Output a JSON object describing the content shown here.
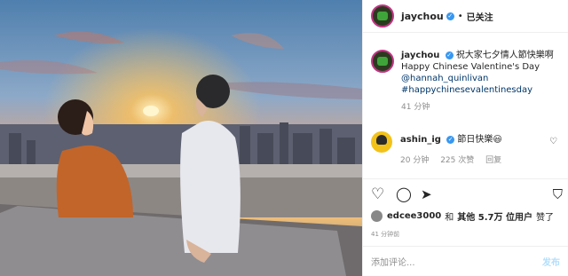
{
  "header": {
    "username": "jaychou",
    "follow_label": "已关注",
    "separator": "•"
  },
  "caption": {
    "username": "jaychou",
    "text_cn": "祝大家七夕情人節快樂啊",
    "text_en": "Happy Chinese Valentine's Day",
    "mention": "@hannah_quinlivan",
    "hashtag": "#happychinesevalentinesday",
    "time": "41 分钟"
  },
  "comment": {
    "username": "ashin_ig",
    "text": "節日快樂😃",
    "time": "20 分钟",
    "likes": "225 次赞",
    "reply": "回复"
  },
  "likes": {
    "liker": "edcee3000",
    "conj": "和",
    "others": "其他 5.7万 位用户",
    "suffix": "赞了"
  },
  "post_time": "41 分钟前",
  "input": {
    "placeholder": "添加评论...",
    "post_label": "发布"
  },
  "icons": {
    "like": "heart-icon",
    "comment": "comment-icon",
    "share": "share-icon",
    "save": "bookmark-icon",
    "verified": "verified-badge-icon"
  },
  "colors": {
    "verified": "#3897f0",
    "link": "#00376b",
    "muted": "#8e8e8e",
    "post_disabled": "#b2dffc"
  }
}
